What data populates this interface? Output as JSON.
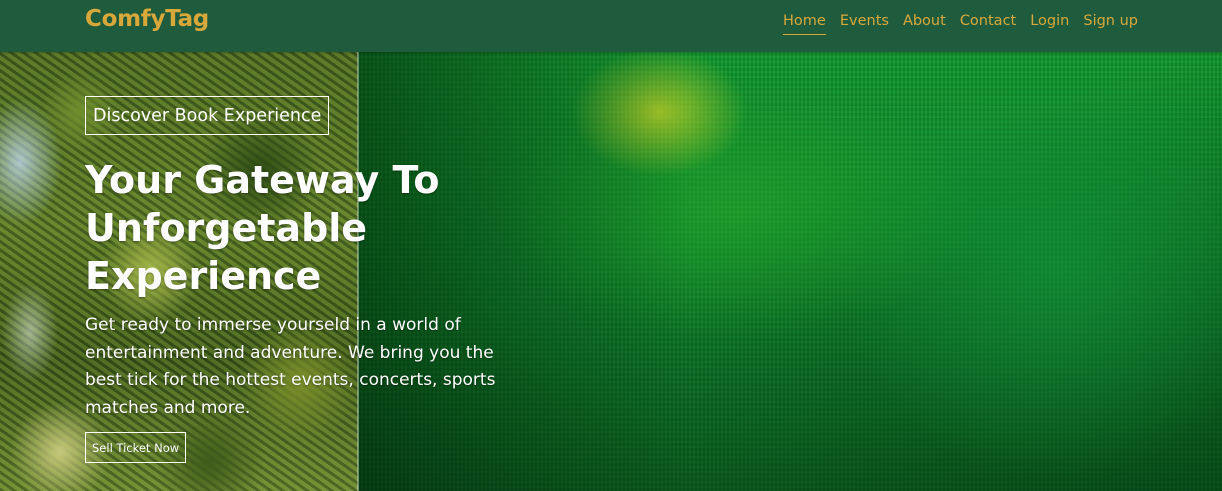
{
  "header": {
    "brand": "ComfyTag",
    "nav": [
      {
        "label": "Home",
        "active": true
      },
      {
        "label": "Events",
        "active": false
      },
      {
        "label": "About",
        "active": false
      },
      {
        "label": "Contact",
        "active": false
      },
      {
        "label": "Login",
        "active": false
      },
      {
        "label": "Sign up",
        "active": false
      }
    ]
  },
  "hero": {
    "tagline": "Discover Book Experience",
    "headline": "Your Gateway To Unforgetable Experience",
    "subtext": "Get ready to immerse yourseld in a world of entertainment and adventure. We bring you the best tick for the hottest events, concerts, sports matches and more.",
    "cta_label": "Sell Ticket Now"
  },
  "colors": {
    "header_bg": "#1f5b3d",
    "accent": "#d9a83a",
    "hero_text": "#ffffff"
  }
}
